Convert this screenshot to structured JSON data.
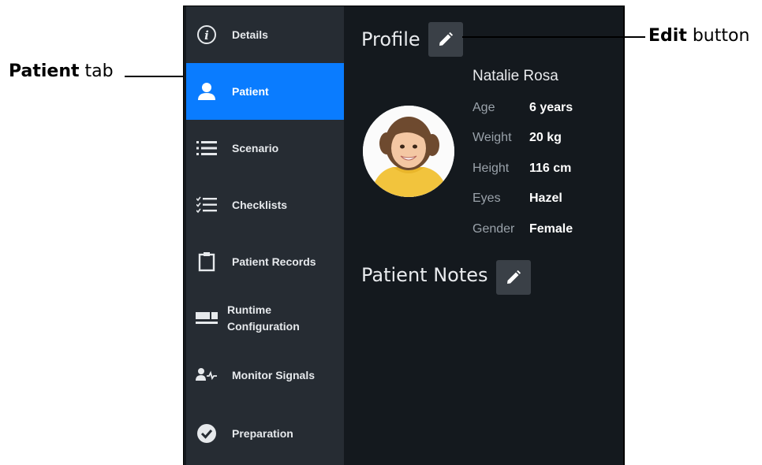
{
  "sidebar": {
    "items": [
      {
        "label": "Details",
        "icon": "info-icon"
      },
      {
        "label": "Patient",
        "icon": "person-icon"
      },
      {
        "label": "Scenario",
        "icon": "list-icon"
      },
      {
        "label": "Checklists",
        "icon": "checklist-icon"
      },
      {
        "label": "Patient Records",
        "icon": "clipboard-icon"
      },
      {
        "label": "Runtime\nConfiguration",
        "icon": "layout-icon"
      },
      {
        "label": "Monitor Signals",
        "icon": "person-signal-icon"
      },
      {
        "label": "Preparation",
        "icon": "check-circle-icon"
      }
    ],
    "active_index": 1
  },
  "profile": {
    "title": "Profile",
    "name": "Natalie Rosa",
    "fields": [
      {
        "key": "Age",
        "value": "6 years"
      },
      {
        "key": "Weight",
        "value": "20 kg"
      },
      {
        "key": "Height",
        "value": "116 cm"
      },
      {
        "key": "Eyes",
        "value": "Hazel"
      },
      {
        "key": "Gender",
        "value": "Female"
      }
    ]
  },
  "notes": {
    "title": "Patient Notes"
  },
  "callouts": {
    "patient_tab_bold": "Patient",
    "patient_tab_rest": " tab",
    "edit_button_bold": "Edit",
    "edit_button_rest": " button"
  },
  "colors": {
    "accent": "#0a7cff",
    "sidebar_bg": "#262c33",
    "main_bg": "#14191e"
  }
}
